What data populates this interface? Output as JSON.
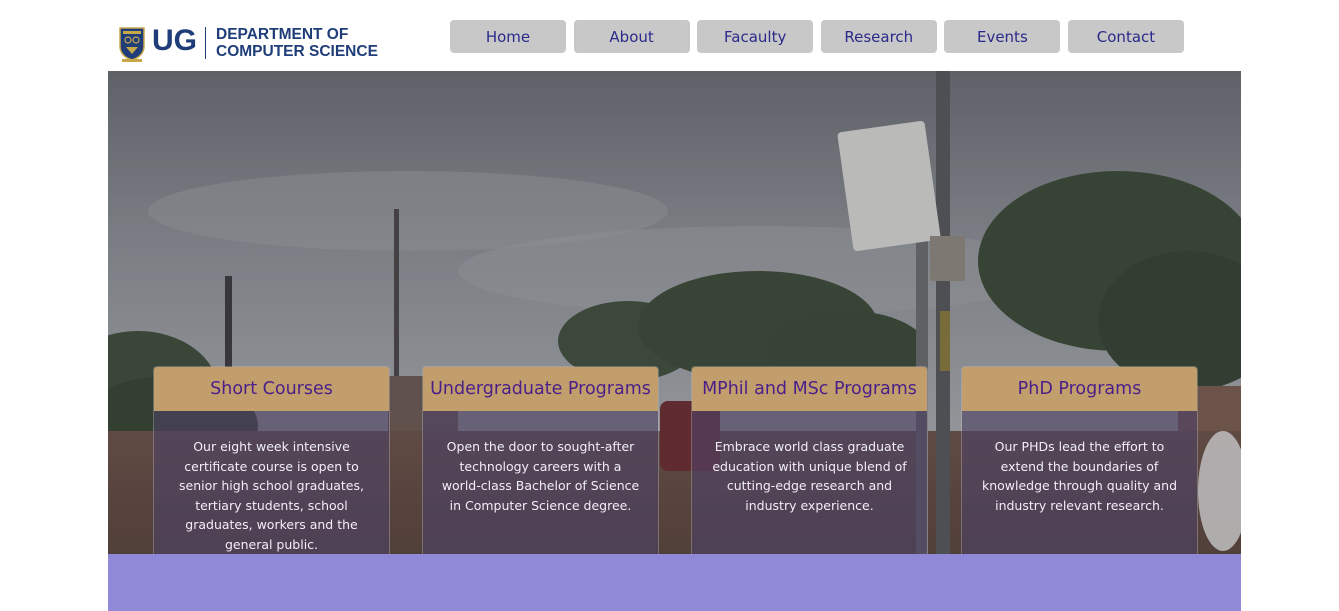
{
  "header": {
    "logo_mark": "UG",
    "dept_line1": "DEPARTMENT OF",
    "dept_line2": "COMPUTER SCIENCE",
    "crest_icon": "university-crest-icon"
  },
  "nav": {
    "items": [
      {
        "label": "Home"
      },
      {
        "label": "About"
      },
      {
        "label": "Facaulty"
      },
      {
        "label": "Research"
      },
      {
        "label": "Events"
      },
      {
        "label": "Contact"
      }
    ]
  },
  "programs": [
    {
      "title": "Short Courses",
      "description": "Our eight week intensive certificate course is open to senior high school graduates, tertiary students, school graduates, workers and the general public."
    },
    {
      "title": "Undergraduate Programs",
      "description": "Open the door to sought-after technology careers with a world-class Bachelor of Science in Computer Science degree."
    },
    {
      "title": "MPhil and MSc Programs",
      "description": "Embrace world class graduate education with unique blend of cutting-edge research and industry experience."
    },
    {
      "title": "PhD Programs",
      "description": "Our PHDs lead the effort to extend the boundaries of knowledge through quality and industry relevant research."
    }
  ],
  "colors": {
    "brand_blue": "#1f3d78",
    "nav_bg": "#c8c8c8",
    "nav_text": "#2a2a8a",
    "card_header": "#c19e6b",
    "card_title": "#4a1f8a",
    "bottom_band": "#8f89d8"
  }
}
